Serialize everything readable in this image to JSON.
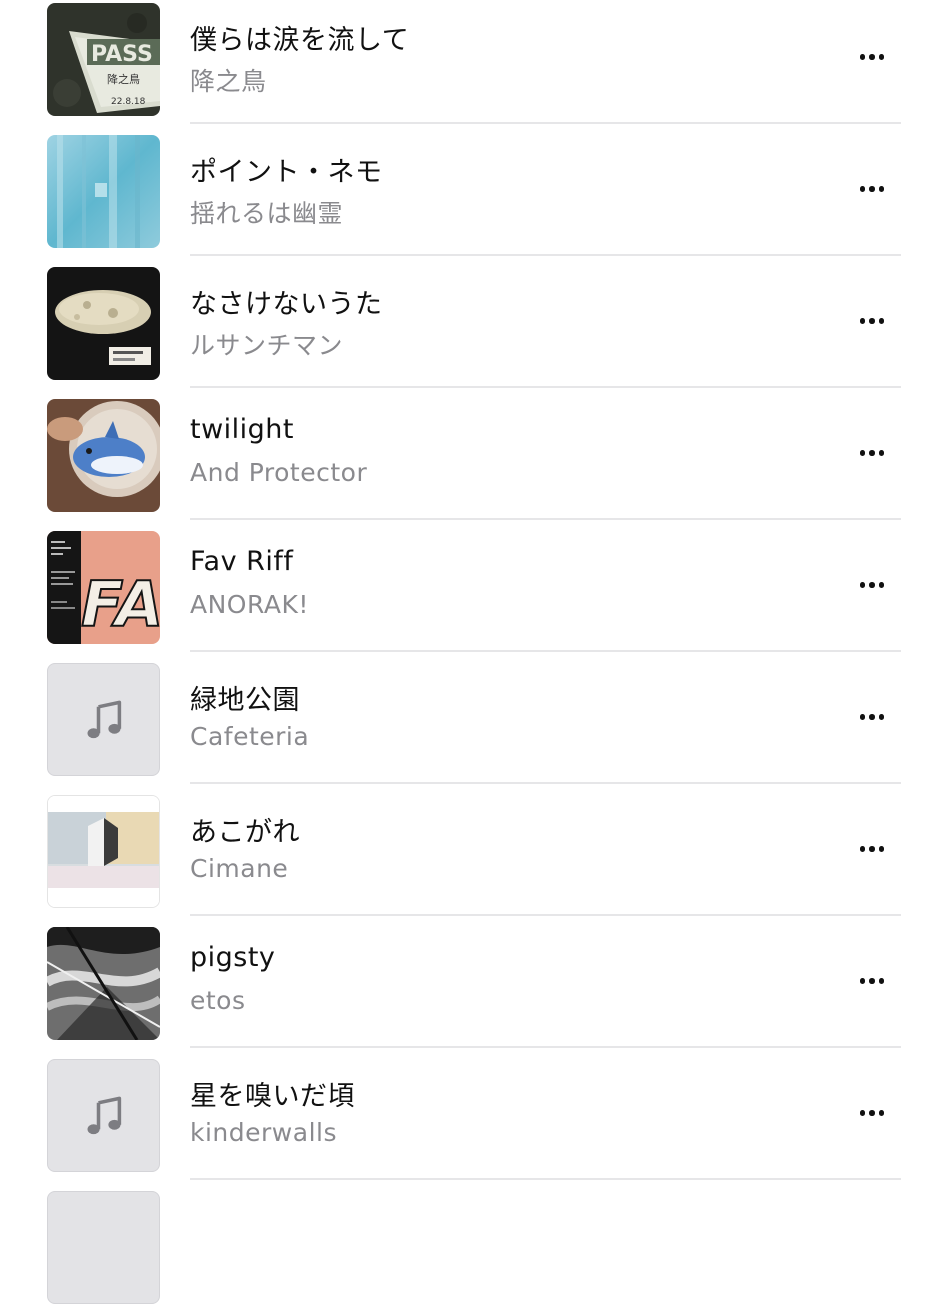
{
  "tracks": [
    {
      "title": "僕らは涙を流して",
      "artist": "降之鳥",
      "art": "pass-ticket",
      "art_text": "PASS"
    },
    {
      "title": "ポイント・ネモ",
      "artist": "揺れるは幽霊",
      "art": "blue-watercolor"
    },
    {
      "title": "なさけないうた",
      "artist": "ルサンチマン",
      "art": "fossil-specimen"
    },
    {
      "title": "twilight",
      "artist": "And Protector",
      "art": "shark-toy"
    },
    {
      "title": "Fav Riff",
      "artist": "ANORAK!",
      "art": "fav-poster",
      "art_text": "FAV"
    },
    {
      "title": "緑地公園",
      "artist": "Cafeteria",
      "art": "music-note-placeholder"
    },
    {
      "title": "あこがれ",
      "artist": "Cimane",
      "art": "room-corner"
    },
    {
      "title": "pigsty",
      "artist": "etos",
      "art": "bw-texture"
    },
    {
      "title": "星を嗅いだ頃",
      "artist": "kinderwalls",
      "art": "music-note-placeholder"
    }
  ],
  "more_icon": "ellipsis-icon",
  "colors": {
    "title": "#111111",
    "subtitle": "#8a8a8e",
    "divider": "#e6e6e8",
    "placeholder_bg": "#e3e3e6",
    "note_icon": "#7d7d82"
  }
}
